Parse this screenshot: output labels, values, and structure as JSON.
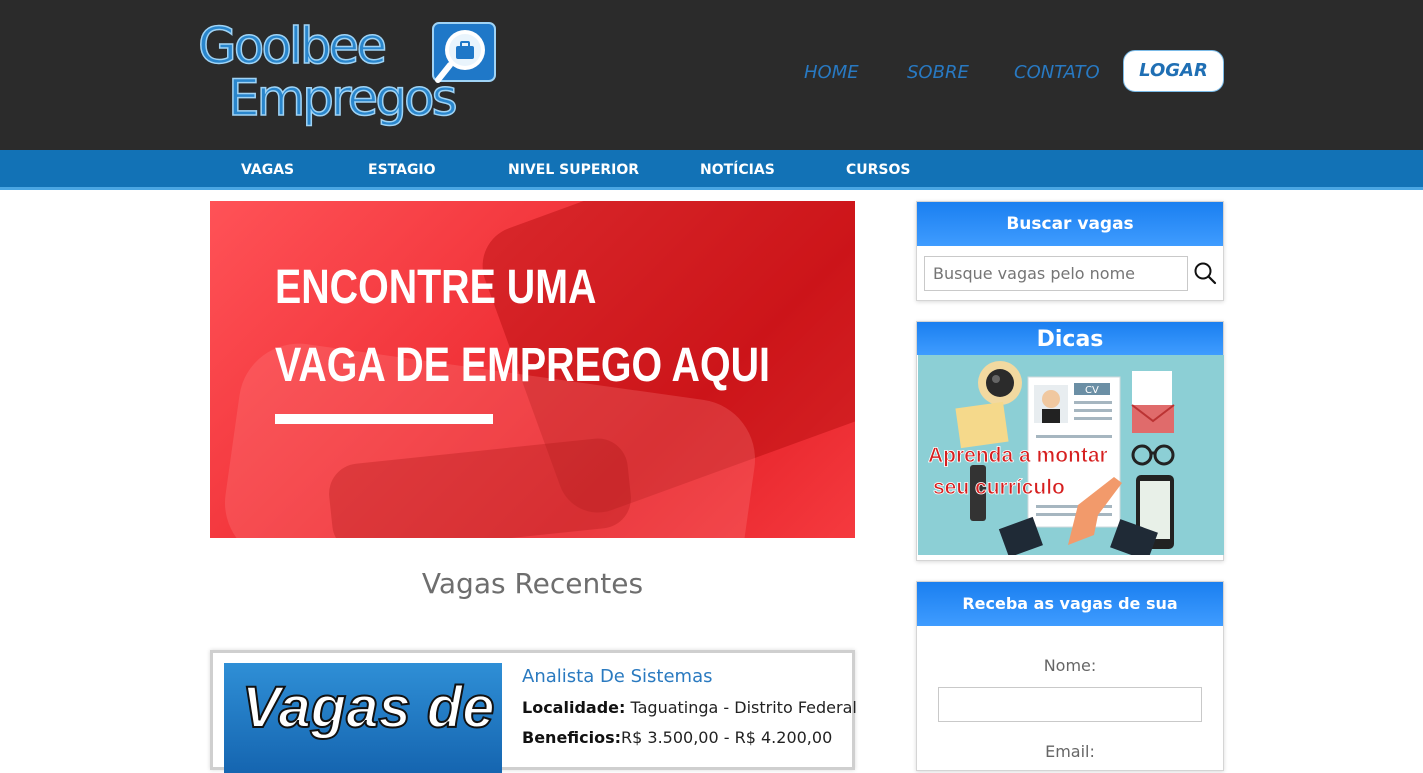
{
  "header": {
    "logo_line1": "Goolbee",
    "logo_line2": "Empregos",
    "nav": [
      "HOME",
      "SOBRE",
      "CONTATO"
    ],
    "login_label": "LOGAR"
  },
  "menu": [
    "VAGAS",
    "ESTAGIO",
    "NIVEL SUPERIOR",
    "NOTÍCIAS",
    "CURSOS"
  ],
  "banner": {
    "line1": "ENCONTRE UMA",
    "line2": "VAGA DE EMPREGO AQUI"
  },
  "recent": {
    "title": "Vagas Recentes",
    "job": {
      "thumb_text": "Vagas de",
      "title": "Analista De Sistemas",
      "location_label": "Localidade:",
      "location_value": " Taguatinga - Distrito Federal",
      "benefits_label": "Beneficios:",
      "benefits_value": "R$ 3.500,00 - R$ 4.200,00"
    }
  },
  "sidebar": {
    "search": {
      "title": "Buscar vagas",
      "placeholder": "Busque vagas pelo nome"
    },
    "tips": {
      "title": "Dicas",
      "image_line1": "Aprenda a montar",
      "image_line2": "seu currículo",
      "cv_label": "CV"
    },
    "subscribe": {
      "title": "Receba as vagas de sua preferência",
      "name_label": "Nome:",
      "email_label": "Email:"
    }
  },
  "colors": {
    "header_bg": "#2b2b2b",
    "menu_bg": "#1272b6",
    "banner_red": "#f2353b",
    "widget_blue": "#1a7ff0",
    "link_blue": "#2879c2"
  }
}
